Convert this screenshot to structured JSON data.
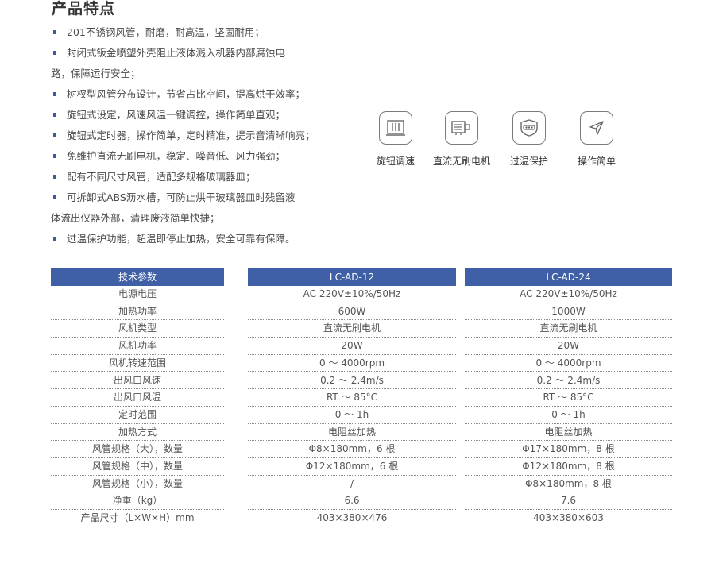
{
  "section_title": "产品特点",
  "features": [
    {
      "line1": "201不锈钢风管，耐磨，耐高温，坚固耐用；",
      "line2": ""
    },
    {
      "line1": "封闭式钣金喷塑外壳阻止液体溅入机器内部腐蚀电",
      "line2": "路，保障运行安全；"
    },
    {
      "line1": "树杈型风管分布设计，节省占比空间，提高烘干效率；",
      "line2": ""
    },
    {
      "line1": "旋钮式设定，风速风温一键调控，操作简单直观；",
      "line2": ""
    },
    {
      "line1": "旋钮式定时器，操作简单，定时精准，提示音清晰响亮；",
      "line2": ""
    },
    {
      "line1": "免维护直流无刷电机，稳定、噪音低、风力强劲；",
      "line2": ""
    },
    {
      "line1": "配有不同尺寸风管，适配多规格玻璃器皿；",
      "line2": ""
    },
    {
      "line1": "可拆卸式ABS沥水槽，可防止烘干玻璃器皿时残留液",
      "line2": "体流出仪器外部，清理废液简单快捷；"
    },
    {
      "line1": "过温保护功能，超温即停止加热，安全可靠有保障。",
      "line2": ""
    }
  ],
  "feature_icons": [
    {
      "label": "旋钮调速",
      "icon": "knob-speed-icon"
    },
    {
      "label": "直流无刷电机",
      "icon": "brushless-motor-icon"
    },
    {
      "label": "过温保护",
      "icon": "overheat-protection-icon"
    },
    {
      "label": "操作简单",
      "icon": "easy-operation-icon"
    }
  ],
  "spec_table": {
    "headers": [
      "技术参数",
      "LC-AD-12",
      "LC-AD-24"
    ],
    "rows": [
      [
        "电源电压",
        "AC 220V±10%/50Hz",
        "AC 220V±10%/50Hz"
      ],
      [
        "加热功率",
        "600W",
        "1000W"
      ],
      [
        "风机类型",
        "直流无刷电机",
        "直流无刷电机"
      ],
      [
        "风机功率",
        "20W",
        "20W"
      ],
      [
        "风机转速范围",
        "0 ～ 4000rpm",
        "0 ～ 4000rpm"
      ],
      [
        "出风口风速",
        "0.2 ～ 2.4m/s",
        "0.2 ～ 2.4m/s"
      ],
      [
        "出风口风温",
        "RT ～ 85°C",
        "RT ～ 85°C"
      ],
      [
        "定时范围",
        "0 ～ 1h",
        "0 ～ 1h"
      ],
      [
        "加热方式",
        "电阻丝加热",
        "电阻丝加热"
      ],
      [
        "风管规格（大），数量",
        "Φ8×180mm，6 根",
        "Φ17×180mm，8 根"
      ],
      [
        "风管规格（中），数量",
        "Φ12×180mm，6 根",
        "Φ12×180mm，8 根"
      ],
      [
        "风管规格（小），数量",
        "/",
        "Φ8×180mm，8 根"
      ],
      [
        "净重（kg）",
        "6.6",
        "7.6"
      ],
      [
        "产品尺寸（L×W×H）mm",
        "403×380×476",
        "403×380×603"
      ]
    ]
  },
  "colors": {
    "accent": "#3f5fa6",
    "bullet": "#3b5aa3",
    "text": "#4a4a4a"
  }
}
